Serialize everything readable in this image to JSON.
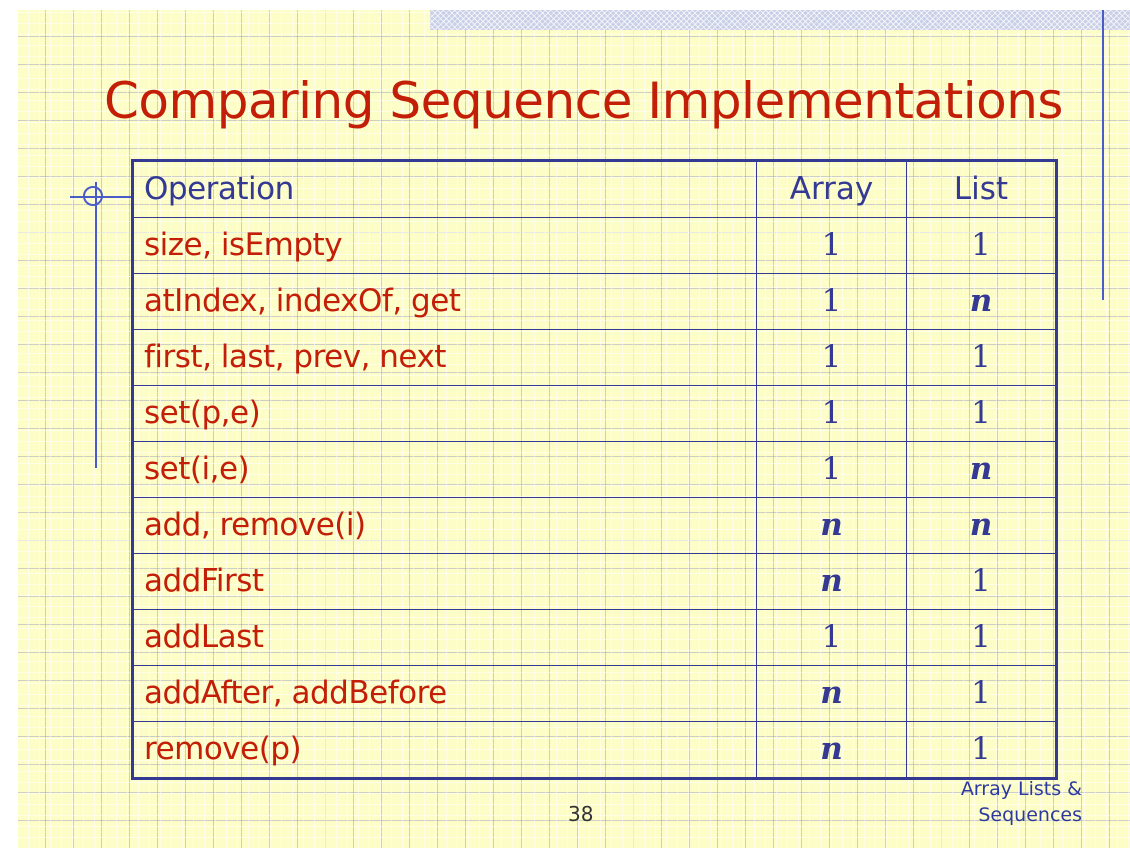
{
  "title": "Comparing Sequence Implementations",
  "table": {
    "headers": [
      "Operation",
      "Array",
      "List"
    ],
    "rows": [
      [
        "size, isEmpty",
        "1",
        "1"
      ],
      [
        "atIndex, indexOf, get",
        "1",
        "n"
      ],
      [
        "first, last, prev, next",
        "1",
        "1"
      ],
      [
        "set(p,e)",
        "1",
        "1"
      ],
      [
        "set(i,e)",
        "1",
        "n"
      ],
      [
        "add, remove(i)",
        "n",
        "n"
      ],
      [
        "addFirst",
        "n",
        "1"
      ],
      [
        "addLast",
        "1",
        "1"
      ],
      [
        "addAfter, addBefore",
        "n",
        "1"
      ],
      [
        "remove(p)",
        "n",
        "1"
      ]
    ]
  },
  "page_number": "38",
  "footer": {
    "line1": "Array Lists &",
    "line2": "Sequences"
  },
  "colors": {
    "title": "#c21e08",
    "table_border": "#343a93",
    "background": "#fdfdc8"
  }
}
